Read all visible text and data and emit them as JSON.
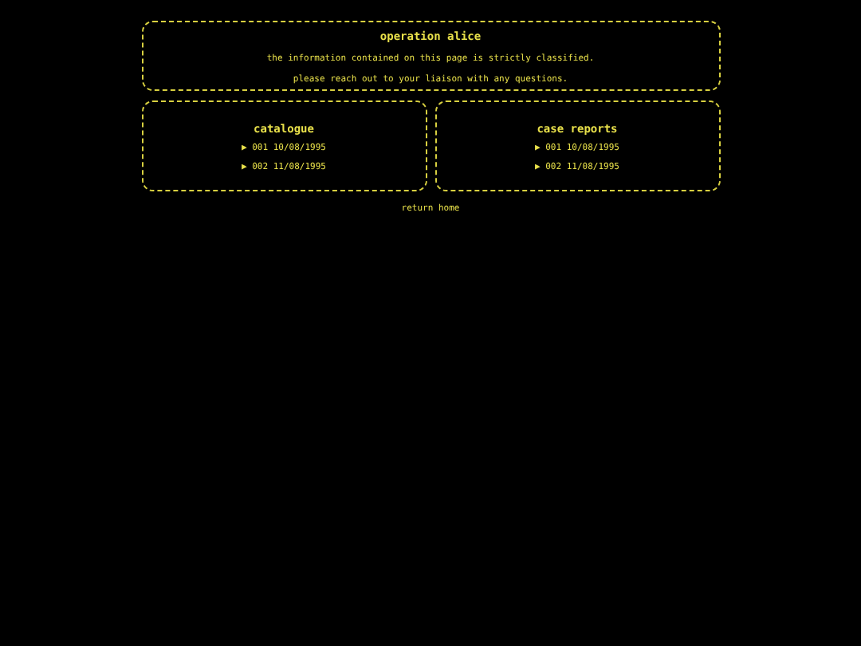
{
  "header": {
    "title": "operation alice",
    "lines": [
      "the information contained on this page is strictly classified.",
      "please reach out to your liaison with any questions."
    ]
  },
  "panels": [
    {
      "title": "catalogue",
      "entries": [
        "▶ 001 10/08/1995",
        "▶ 002 11/08/1995"
      ]
    },
    {
      "title": "case reports",
      "entries": [
        "▶ 001 10/08/1995",
        "▶ 002 11/08/1995"
      ]
    }
  ],
  "footer_link": "return home"
}
